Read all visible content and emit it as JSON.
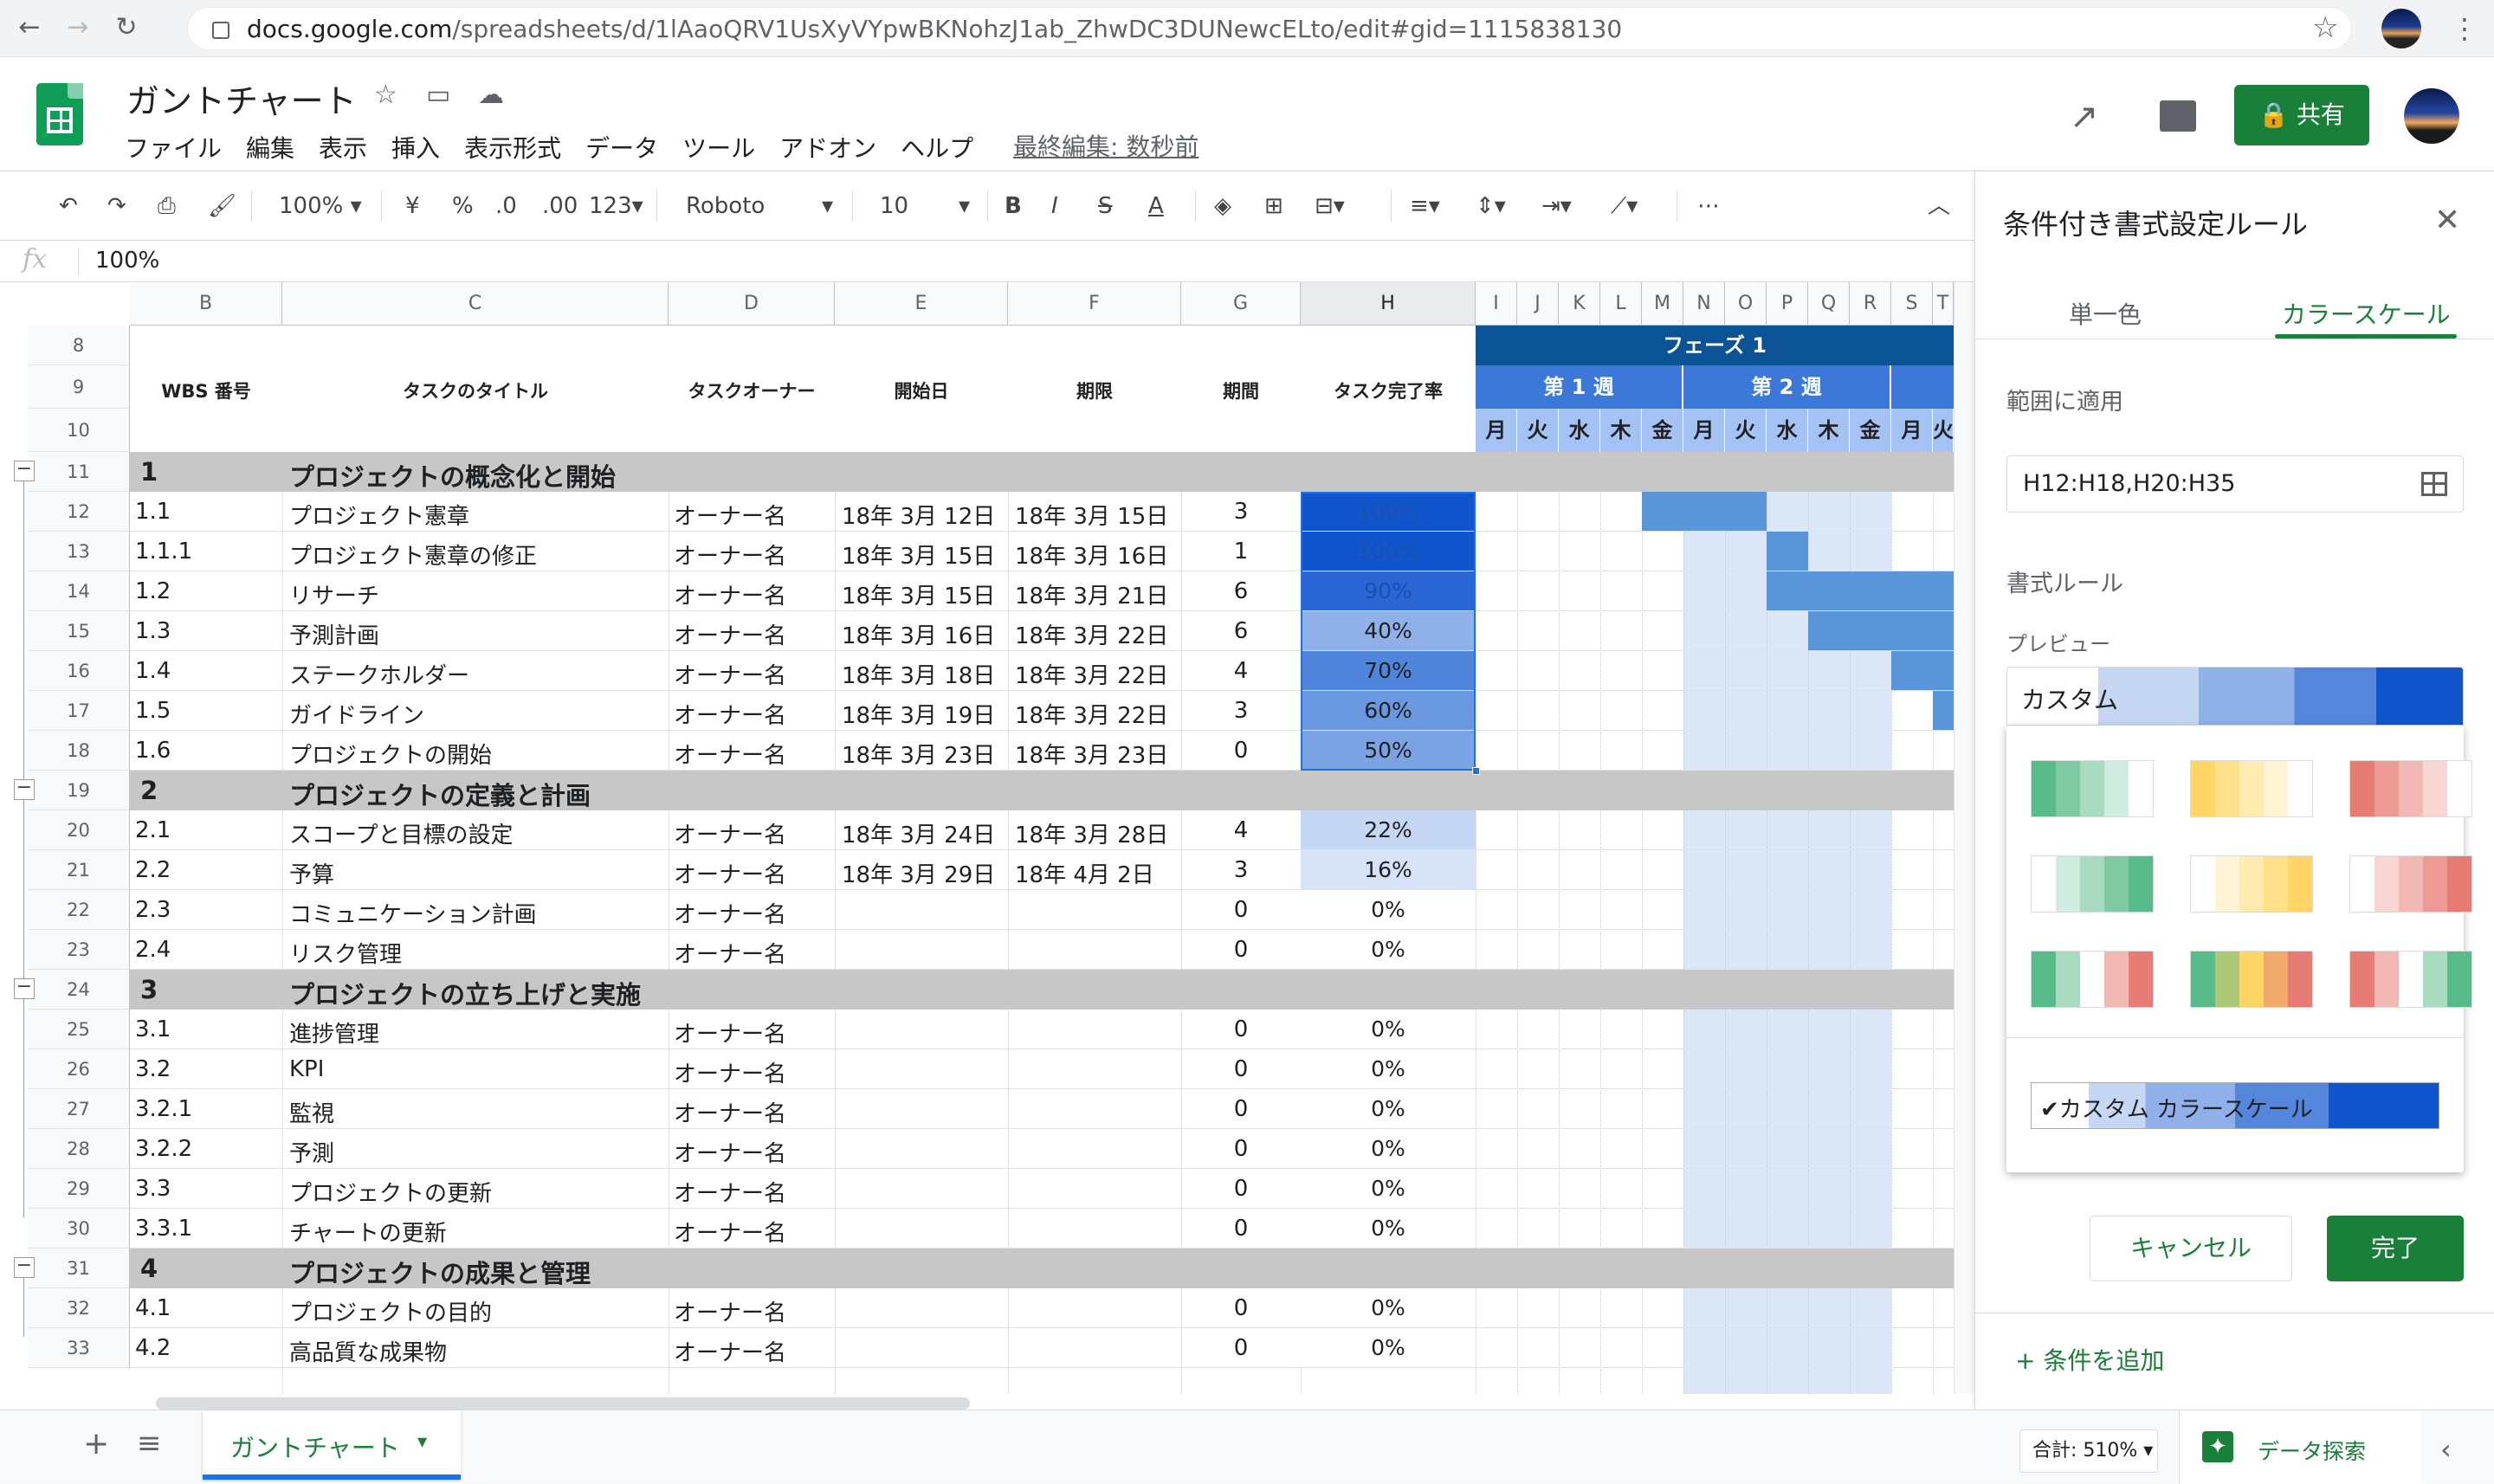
{
  "browser": {
    "url_domain": "docs.google.com",
    "url_path": "/spreadsheets/d/1lAaoQRV1UsXyVYpwBKNohzJ1ab_ZhwDC3DUNewcELto/edit#gid=1115838130"
  },
  "doc": {
    "title": "ガントチャート",
    "last_edit": "最終編集: 数秒前",
    "share_label": "共有"
  },
  "menu": [
    "ファイル",
    "編集",
    "表示",
    "挿入",
    "表示形式",
    "データ",
    "ツール",
    "アドオン",
    "ヘルプ"
  ],
  "toolbar": {
    "zoom": "100%",
    "currency": "¥",
    "percent": "%",
    "dec_less": ".0",
    "dec_more": ".00",
    "format": "123",
    "font": "Roboto",
    "font_size": "10",
    "bold": "B",
    "italic": "I",
    "strike": "S",
    "text_color": "A"
  },
  "formula": {
    "fx": "fx",
    "value": "100%"
  },
  "columns": [
    "B",
    "C",
    "D",
    "E",
    "F",
    "G",
    "H",
    "I",
    "J",
    "K",
    "L",
    "M",
    "N",
    "O",
    "P",
    "Q",
    "R",
    "S",
    "T"
  ],
  "header_labels": {
    "wbs": "WBS 番号",
    "title": "タスクのタイトル",
    "owner": "タスクオーナー",
    "start": "開始日",
    "due": "期限",
    "duration": "期間",
    "progress": "タスク完了率"
  },
  "gantt": {
    "phase": "フェーズ 1",
    "week1": "第 1 週",
    "week2": "第 2 週",
    "days": [
      "月",
      "火",
      "水",
      "木",
      "金",
      "月",
      "火",
      "水",
      "木",
      "金",
      "月",
      "火"
    ]
  },
  "row_numbers": [
    "8",
    "9",
    "10",
    "11",
    "12",
    "13",
    "14",
    "15",
    "16",
    "17",
    "18",
    "19",
    "20",
    "21",
    "22",
    "23",
    "24",
    "25",
    "26",
    "27",
    "28",
    "29",
    "30",
    "31",
    "32",
    "33"
  ],
  "sections": [
    {
      "num": "1",
      "title": "プロジェクトの概念化と開始"
    },
    {
      "num": "2",
      "title": "プロジェクトの定義と計画"
    },
    {
      "num": "3",
      "title": "プロジェクトの立ち上げと実施"
    },
    {
      "num": "4",
      "title": "プロジェクトの成果と管理"
    }
  ],
  "tasks": [
    {
      "wbs": "1.1",
      "title": "プロジェクト憲章",
      "owner": "オーナー名",
      "start": "18年 3月 12日",
      "due": "18年 3月 15日",
      "duration": "3",
      "progress": "100%"
    },
    {
      "wbs": "1.1.1",
      "title": "プロジェクト憲章の修正",
      "owner": "オーナー名",
      "start": "18年 3月 15日",
      "due": "18年 3月 16日",
      "duration": "1",
      "progress": "100%"
    },
    {
      "wbs": "1.2",
      "title": "リサーチ",
      "owner": "オーナー名",
      "start": "18年 3月 15日",
      "due": "18年 3月 21日",
      "duration": "6",
      "progress": "90%"
    },
    {
      "wbs": "1.3",
      "title": "予測計画",
      "owner": "オーナー名",
      "start": "18年 3月 16日",
      "due": "18年 3月 22日",
      "duration": "6",
      "progress": "40%"
    },
    {
      "wbs": "1.4",
      "title": "ステークホルダー",
      "owner": "オーナー名",
      "start": "18年 3月 18日",
      "due": "18年 3月 22日",
      "duration": "4",
      "progress": "70%"
    },
    {
      "wbs": "1.5",
      "title": "ガイドライン",
      "owner": "オーナー名",
      "start": "18年 3月 19日",
      "due": "18年 3月 22日",
      "duration": "3",
      "progress": "60%"
    },
    {
      "wbs": "1.6",
      "title": "プロジェクトの開始",
      "owner": "オーナー名",
      "start": "18年 3月 23日",
      "due": "18年 3月 23日",
      "duration": "0",
      "progress": "50%"
    },
    {
      "wbs": "2.1",
      "title": "スコープと目標の設定",
      "owner": "オーナー名",
      "start": "18年 3月 24日",
      "due": "18年 3月 28日",
      "duration": "4",
      "progress": "22%"
    },
    {
      "wbs": "2.2",
      "title": "予算",
      "owner": "オーナー名",
      "start": "18年 3月 29日",
      "due": "18年 4月 2日",
      "duration": "3",
      "progress": "16%"
    },
    {
      "wbs": "2.3",
      "title": "コミュニケーション計画",
      "owner": "オーナー名",
      "start": "",
      "due": "",
      "duration": "0",
      "progress": "0%"
    },
    {
      "wbs": "2.4",
      "title": "リスク管理",
      "owner": "オーナー名",
      "start": "",
      "due": "",
      "duration": "0",
      "progress": "0%"
    },
    {
      "wbs": "3.1",
      "title": "進捗管理",
      "owner": "オーナー名",
      "start": "",
      "due": "",
      "duration": "0",
      "progress": "0%"
    },
    {
      "wbs": "3.2",
      "title": "KPI",
      "owner": "オーナー名",
      "start": "",
      "due": "",
      "duration": "0",
      "progress": "0%"
    },
    {
      "wbs": "3.2.1",
      "title": "監視",
      "owner": "オーナー名",
      "start": "",
      "due": "",
      "duration": "0",
      "progress": "0%"
    },
    {
      "wbs": "3.2.2",
      "title": "予測",
      "owner": "オーナー名",
      "start": "",
      "due": "",
      "duration": "0",
      "progress": "0%"
    },
    {
      "wbs": "3.3",
      "title": "プロジェクトの更新",
      "owner": "オーナー名",
      "start": "",
      "due": "",
      "duration": "0",
      "progress": "0%"
    },
    {
      "wbs": "3.3.1",
      "title": "チャートの更新",
      "owner": "オーナー名",
      "start": "",
      "due": "",
      "duration": "0",
      "progress": "0%"
    },
    {
      "wbs": "4.1",
      "title": "プロジェクトの目的",
      "owner": "オーナー名",
      "start": "",
      "due": "",
      "duration": "0",
      "progress": "0%"
    },
    {
      "wbs": "4.2",
      "title": "高品質な成果物",
      "owner": "オーナー名",
      "start": "",
      "due": "",
      "duration": "0",
      "progress": "0%"
    }
  ],
  "panel": {
    "title": "条件付き書式設定ルール",
    "tab_single": "単一色",
    "tab_scale": "カラースケール",
    "range_label": "範囲に適用",
    "range_value": "H12:H18,H20:H35",
    "rules_label": "書式ルール",
    "preview_label": "プレビュー",
    "preview_text": "カスタム",
    "custom_scale_label": "✔カスタム カラースケール",
    "cancel": "キャンセル",
    "done": "完了",
    "add_rule": "+ 条件を追加"
  },
  "scale_colors": {
    "green_white": [
      "#57bb8a",
      "#7fcaa2",
      "#a8dbbf",
      "#d0ece0",
      "#ffffff"
    ],
    "yellow_white": [
      "#ffd666",
      "#ffe08a",
      "#ffeab0",
      "#fff4d6",
      "#ffffff"
    ],
    "red_white": [
      "#e67c73",
      "#ec9a93",
      "#f2b8b3",
      "#f8d6d3",
      "#ffffff"
    ],
    "white_green": [
      "#ffffff",
      "#d0ece0",
      "#a8dbbf",
      "#7fcaa2",
      "#57bb8a"
    ],
    "white_yellow": [
      "#ffffff",
      "#fff4d6",
      "#ffeab0",
      "#ffe08a",
      "#ffd666"
    ],
    "white_red": [
      "#ffffff",
      "#f8d6d3",
      "#f2b8b3",
      "#ec9a93",
      "#e67c73"
    ],
    "green_white_red": [
      "#57bb8a",
      "#a8dbbf",
      "#ffffff",
      "#f2b8b3",
      "#e67c73"
    ],
    "green_yellow_red": [
      "#57bb8a",
      "#abc978",
      "#ffd666",
      "#f2a96c",
      "#e67c73"
    ],
    "red_white_green": [
      "#e67c73",
      "#f2b8b3",
      "#ffffff",
      "#a8dbbf",
      "#57bb8a"
    ]
  },
  "bottom": {
    "sheet_name": "ガントチャート",
    "sum": "合計: 510%",
    "explore": "データ探索"
  },
  "colors": {
    "accent_green": "#188038",
    "header_blue": "#0b5394",
    "week_blue": "#3c78d8",
    "day_blue": "#a4c2f4",
    "bar_blue": "#5b95d9",
    "selection_blue": "#1a73e8"
  }
}
